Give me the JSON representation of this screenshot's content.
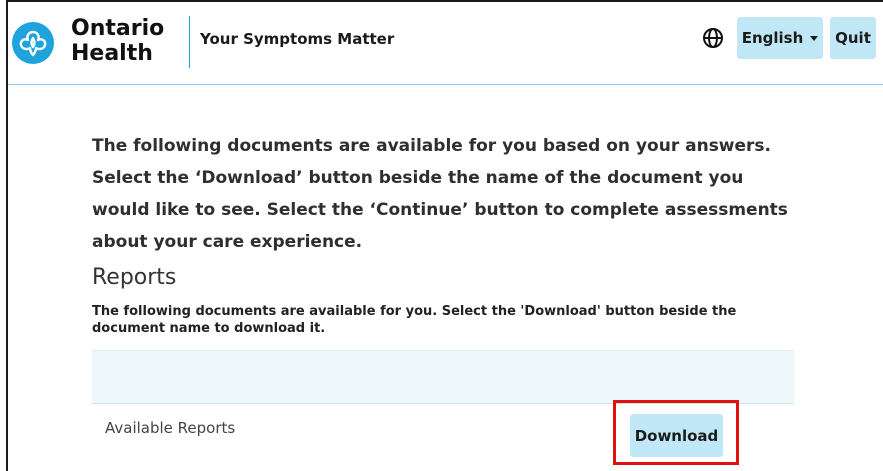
{
  "header": {
    "logo_line1": "Ontario",
    "logo_line2": "Health",
    "app_title": "Your Symptoms Matter",
    "language_label": "English",
    "quit_label": "Quit"
  },
  "main": {
    "intro": "The following documents are available for you based on your answers. Select the ‘Download’ button beside the name of the document you would like to see. Select the ‘Continue’ button to complete assessments about your care experience.",
    "reports": {
      "title": "Reports",
      "description": "The following documents are available for you. Select the 'Download' button beside the document name to download it.",
      "rows": [
        {
          "label": "Available Reports",
          "action": "Download"
        }
      ]
    }
  },
  "colors": {
    "brand_blue": "#1ea3dc",
    "button_bg": "#bfe7f5",
    "highlight": "#e31010"
  },
  "icons": {
    "logo": "ontario-trillium-logo-icon",
    "globe": "globe-icon",
    "dropdown": "chevron-down-icon"
  }
}
